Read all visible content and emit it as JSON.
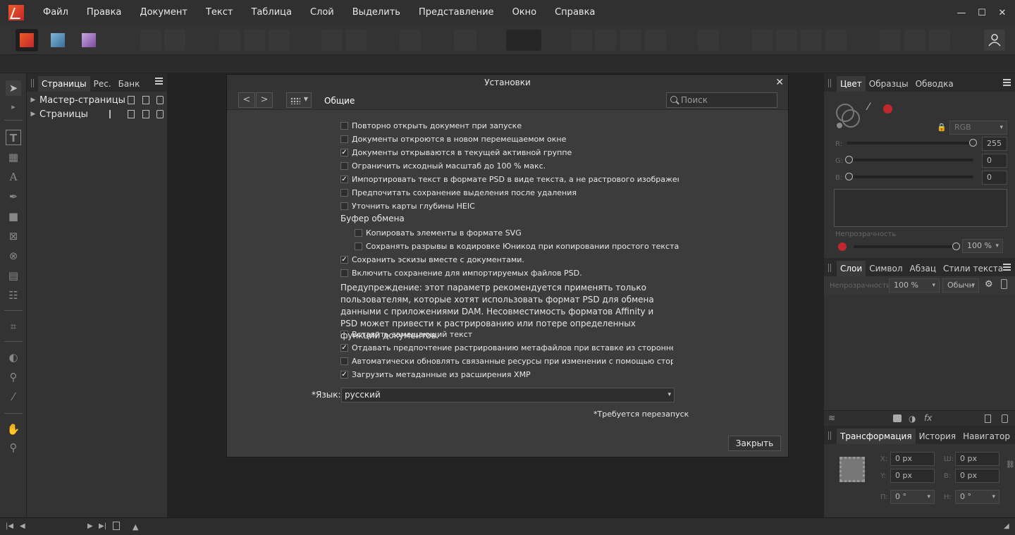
{
  "menu": [
    "Файл",
    "Правка",
    "Документ",
    "Текст",
    "Таблица",
    "Слой",
    "Выделить",
    "Представление",
    "Окно",
    "Справка"
  ],
  "window_controls": {
    "minimize": "—",
    "maximize": "☐",
    "close": "✕"
  },
  "pages_panel": {
    "tabs": [
      "Страницы",
      "Рес.",
      "Банк"
    ],
    "rows": [
      "Мастер-страницы",
      "Страницы"
    ]
  },
  "dialog": {
    "title": "Установки",
    "close": "✕",
    "nav_back": "<",
    "nav_forward": ">",
    "section": "Общие",
    "search_placeholder": "Поиск",
    "options": [
      {
        "label": "Повторно открыть документ при запуске",
        "checked": false
      },
      {
        "label": "Документы откроются в новом перемещаемом окне",
        "checked": false
      },
      {
        "label": "Документы открываются в текущей активной группе",
        "checked": true
      },
      {
        "label": "Ограничить исходный масштаб до 100 % макс.",
        "checked": false
      },
      {
        "label": "Импортировать текст в формате PSD в виде текста, а не растрового изображения",
        "checked": true
      },
      {
        "label": "Предпочитать сохранение выделения после удаления",
        "checked": false
      },
      {
        "label": "Уточнить карты глубины HEIC",
        "checked": false
      }
    ],
    "clipboard_group": "Буфер обмена",
    "clipboard_options": [
      {
        "label": "Копировать элементы в формате SVG",
        "checked": false
      },
      {
        "label": "Сохранять разрывы в кодировке Юникод при копировании простого текста",
        "checked": false
      }
    ],
    "options2": [
      {
        "label": "Сохранить эскизы вместе с документами.",
        "checked": true
      },
      {
        "label": "Включить сохранение для импортируемых файлов PSD.",
        "checked": false
      }
    ],
    "warning": "Предупреждение: этот параметр рекомендуется применять только пользователям, которые хотят использовать формат PSD для обмена данными с приложениями DAM. Несовместимость форматов Affinity и PSD может привести к растрированию или потере определенных функций документов.",
    "options3": [
      {
        "label": "Вставить замещающий текст",
        "checked": false
      },
      {
        "label": "Отдавать предпочтение растрированию метафайлов при вставке из стороннего приложе",
        "checked": true
      },
      {
        "label": "Автоматически обновлять связанные ресурсы при изменении с помощью стороннего пр",
        "checked": false
      },
      {
        "label": "Загрузить метаданные из расширения XMP",
        "checked": true
      }
    ],
    "language_label": "*Язык:",
    "language_value": "русский",
    "restart_note": "*Требуется перезапуск",
    "close_button": "Закрыть"
  },
  "color_panel": {
    "tabs": [
      "Цвет",
      "Образцы",
      "Обводка"
    ],
    "mode": "RGB",
    "r_label": "R:",
    "r_value": "255",
    "g_label": "G:",
    "g_value": "0",
    "b_label": "B:",
    "b_value": "0",
    "opacity_label": "Непрозрачность",
    "opacity_value": "100 %"
  },
  "layers_panel": {
    "tabs": [
      "Слои",
      "Символ",
      "Абзац",
      "Стили текста"
    ],
    "opacity_label": "Непрозрачность:",
    "opacity_value": "100 %",
    "blend": "Обычн",
    "fx": "fx"
  },
  "transform_panel": {
    "tabs": [
      "Трансформация",
      "История",
      "Навигатор"
    ],
    "x_label": "X:",
    "x_value": "0 px",
    "w_label": "Ш:",
    "w_value": "0 px",
    "y_label": "Y:",
    "y_value": "0 px",
    "h_label": "В:",
    "h_value": "0 px",
    "r_label": "П:",
    "r_value": "0 °",
    "s_label": "Н:",
    "s_value": "0 °"
  },
  "colors": {
    "accent": "#c1272d",
    "bg": "#2b2b2b",
    "dialog": "#3c3c3c"
  }
}
